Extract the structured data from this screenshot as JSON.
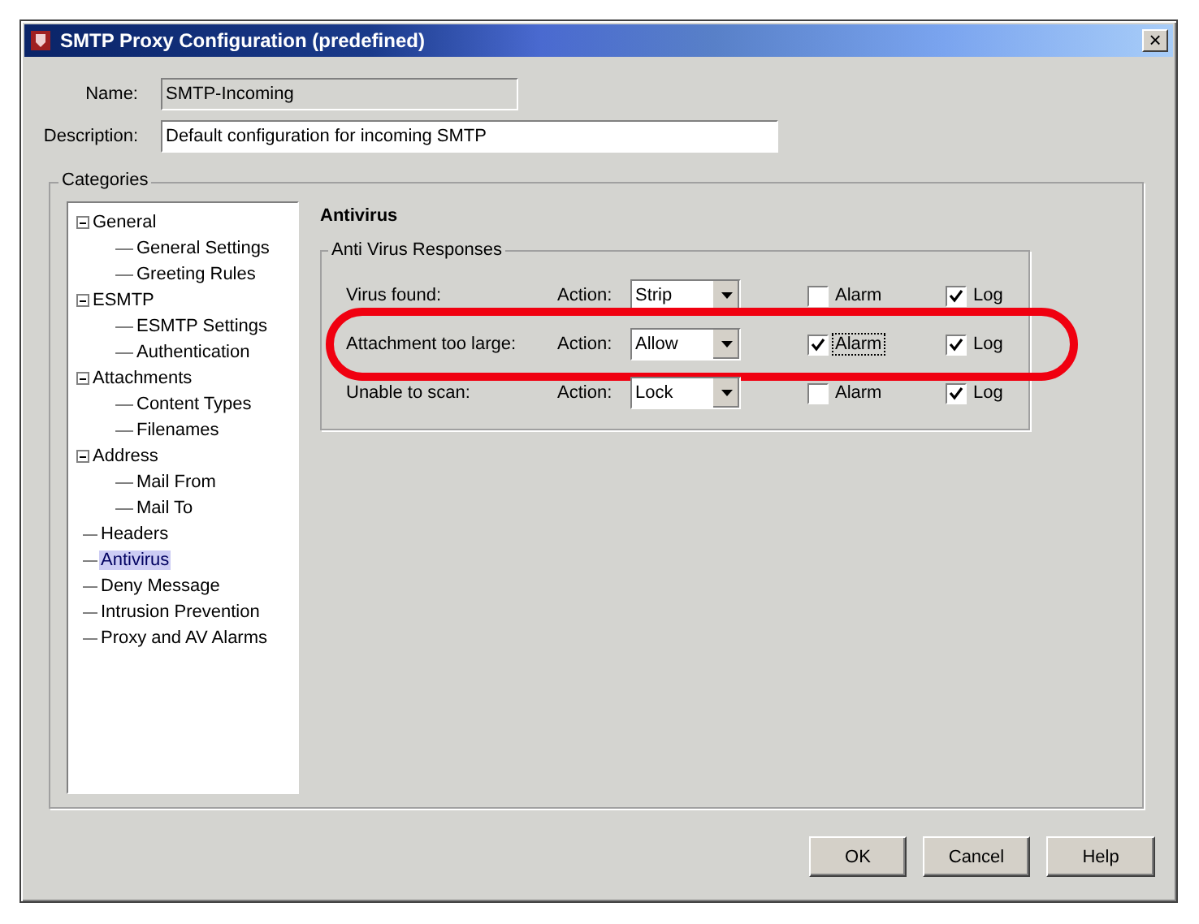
{
  "window": {
    "title": "SMTP Proxy Configuration (predefined)",
    "close": "×"
  },
  "fields": [
    {
      "label": "Name:",
      "value": "SMTP-Incoming",
      "disabled": true
    },
    {
      "label": "Description:",
      "value": "Default configuration for incoming SMTP",
      "disabled": false
    }
  ],
  "categories": {
    "title": "Categories",
    "tree": [
      {
        "label": "General",
        "expanded": true,
        "selected": false,
        "children": [
          {
            "label": "General Settings",
            "selected": false
          },
          {
            "label": "Greeting Rules",
            "selected": false
          }
        ]
      },
      {
        "label": "ESMTP",
        "expanded": true,
        "selected": false,
        "children": [
          {
            "label": "ESMTP Settings",
            "selected": false
          },
          {
            "label": "Authentication",
            "selected": false
          }
        ]
      },
      {
        "label": "Attachments",
        "expanded": true,
        "selected": false,
        "children": [
          {
            "label": "Content Types",
            "selected": false
          },
          {
            "label": "Filenames",
            "selected": false
          }
        ]
      },
      {
        "label": "Address",
        "expanded": true,
        "selected": false,
        "children": [
          {
            "label": "Mail From",
            "selected": false
          },
          {
            "label": "Mail To",
            "selected": false
          }
        ]
      },
      {
        "label": "Headers",
        "selected": false
      },
      {
        "label": "Antivirus",
        "selected": true
      },
      {
        "label": "Deny Message",
        "selected": false
      },
      {
        "label": "Intrusion Prevention",
        "selected": false
      },
      {
        "label": "Proxy and AV Alarms",
        "selected": false
      }
    ]
  },
  "panel": {
    "heading": "Antivirus",
    "group": "Anti Virus Responses",
    "rows": [
      {
        "label": "Virus found:",
        "action_label": "Action:",
        "action": "Strip",
        "alarm": {
          "label": "Alarm",
          "checked": false
        },
        "log": {
          "label": "Log",
          "checked": true
        },
        "highlighted": false
      },
      {
        "label": "Attachment too large:",
        "action_label": "Action:",
        "action": "Allow",
        "alarm": {
          "label": "Alarm",
          "checked": true
        },
        "log": {
          "label": "Log",
          "checked": true
        },
        "highlighted": true
      },
      {
        "label": "Unable to scan:",
        "action_label": "Action:",
        "action": "Lock",
        "alarm": {
          "label": "Alarm",
          "checked": false
        },
        "log": {
          "label": "Log",
          "checked": true
        },
        "highlighted": false
      }
    ]
  },
  "buttons": [
    "OK",
    "Cancel",
    "Help"
  ]
}
